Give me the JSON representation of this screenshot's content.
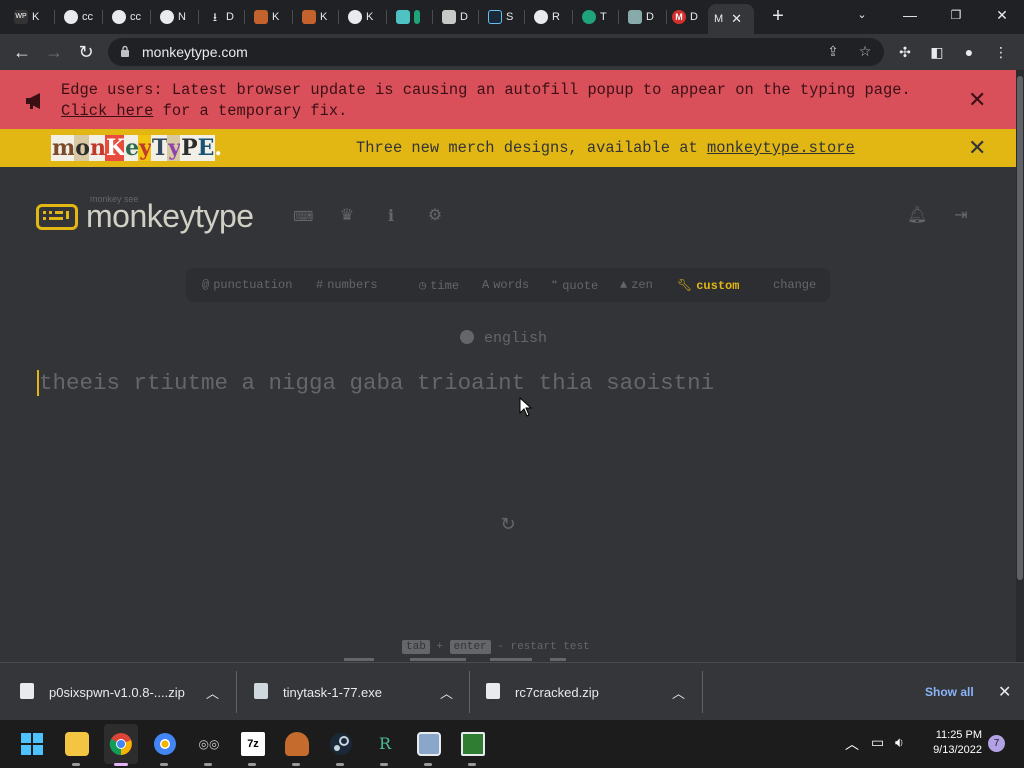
{
  "browser": {
    "tabs": [
      {
        "label": "K",
        "fav": "WP",
        "color": "#333"
      },
      {
        "label": "cc",
        "fav": "",
        "color": "#555"
      },
      {
        "label": "cc",
        "fav": "",
        "color": "#555"
      },
      {
        "label": "N",
        "fav": "",
        "color": "#555"
      },
      {
        "label": "D",
        "fav": "↓",
        "color": "#202124"
      },
      {
        "label": "K",
        "fav": "",
        "color": "#c4622d"
      },
      {
        "label": "K",
        "fav": "",
        "color": "#c4622d"
      },
      {
        "label": "K",
        "fav": "",
        "color": "#555"
      },
      {
        "label": "",
        "fav": "",
        "color": "#4fc3c4"
      },
      {
        "label": "D",
        "fav": "",
        "color": "#999"
      },
      {
        "label": "S",
        "fav": "",
        "color": "#1b2838"
      },
      {
        "label": "R",
        "fav": "",
        "color": "#333"
      },
      {
        "label": "T",
        "fav": "cc",
        "color": "#1fa37a"
      },
      {
        "label": "D",
        "fav": "",
        "color": "#8aa"
      },
      {
        "label": "D",
        "fav": "M",
        "color": "#d32f2f"
      },
      {
        "label": "M",
        "fav": "",
        "color": "#202124"
      }
    ],
    "active_tab_label": "M",
    "new_tab_label": "+",
    "url": "monkeytype.com"
  },
  "banners": {
    "edge_notice_text": "Edge users: Latest browser update is causing an autofill popup to appear on the typing page.",
    "edge_notice_link": "Click here",
    "edge_notice_suffix": " for a temporary fix.",
    "merch_logo": "monKeyTyPE.",
    "merch_text": "Three new merch designs, available at ",
    "merch_link": "monkeytype.store",
    "close_glyph": "✕"
  },
  "header": {
    "logo_sub": "monkey see",
    "logo_text": "monkeytype"
  },
  "config": {
    "punctuation": "punctuation",
    "numbers": "numbers",
    "time": "time",
    "words": "words",
    "quote": "quote",
    "zen": "zen",
    "custom": "custom",
    "change": "change"
  },
  "test": {
    "language": "english",
    "words": "theeis rtiutme a nigga gaba trioaint thia saoistni"
  },
  "footer": {
    "key_tab": "tab",
    "plus": "+",
    "key_enter": "enter",
    "hint": "- restart test"
  },
  "downloads": {
    "items": [
      {
        "name": "p0sixspwn-v1.0.8-....zip"
      },
      {
        "name": "tinytask-1-77.exe"
      },
      {
        "name": "rc7cracked.zip"
      }
    ],
    "show_all": "Show all"
  },
  "taskbar": {
    "time": "11:25 PM",
    "date": "9/13/2022",
    "notification_count": "7"
  },
  "colors": {
    "accent": "#e2b714",
    "bg": "#323437",
    "sub": "#646669",
    "text": "#d1d0c5",
    "error_banner": "#d9505a"
  }
}
